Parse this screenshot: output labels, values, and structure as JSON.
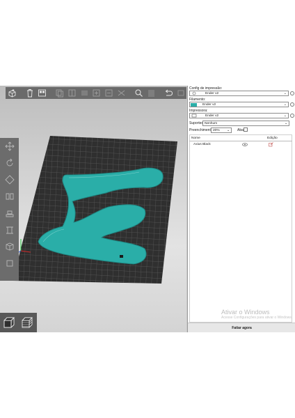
{
  "panel": {
    "print_config_label": "Config de impressão:",
    "print_config_value": "Ender v2",
    "filament_label": "Filamento:",
    "filament_value": "Ender v2",
    "filament_color": "#2aaea8",
    "printer_label": "Impressora:",
    "printer_value": "Ender v2",
    "supports_label": "Suportes:",
    "supports_value": "Nenhum",
    "infill_label": "Preenchimento:",
    "infill_value": "20%",
    "brim_label": "Aba:",
    "table": {
      "col_name": "Nome",
      "col_edit": "Edição",
      "rows": [
        {
          "name": "Axius Black"
        }
      ]
    },
    "slice_button": "Fatiar agora"
  },
  "watermark": {
    "title": "Ativar o Windows",
    "subtitle": "Acesse Configurações para ativar o Windows."
  },
  "colors": {
    "model": "#2aaea8",
    "bed": "#2f2f2f",
    "toolbar": "#6a6a6a"
  }
}
